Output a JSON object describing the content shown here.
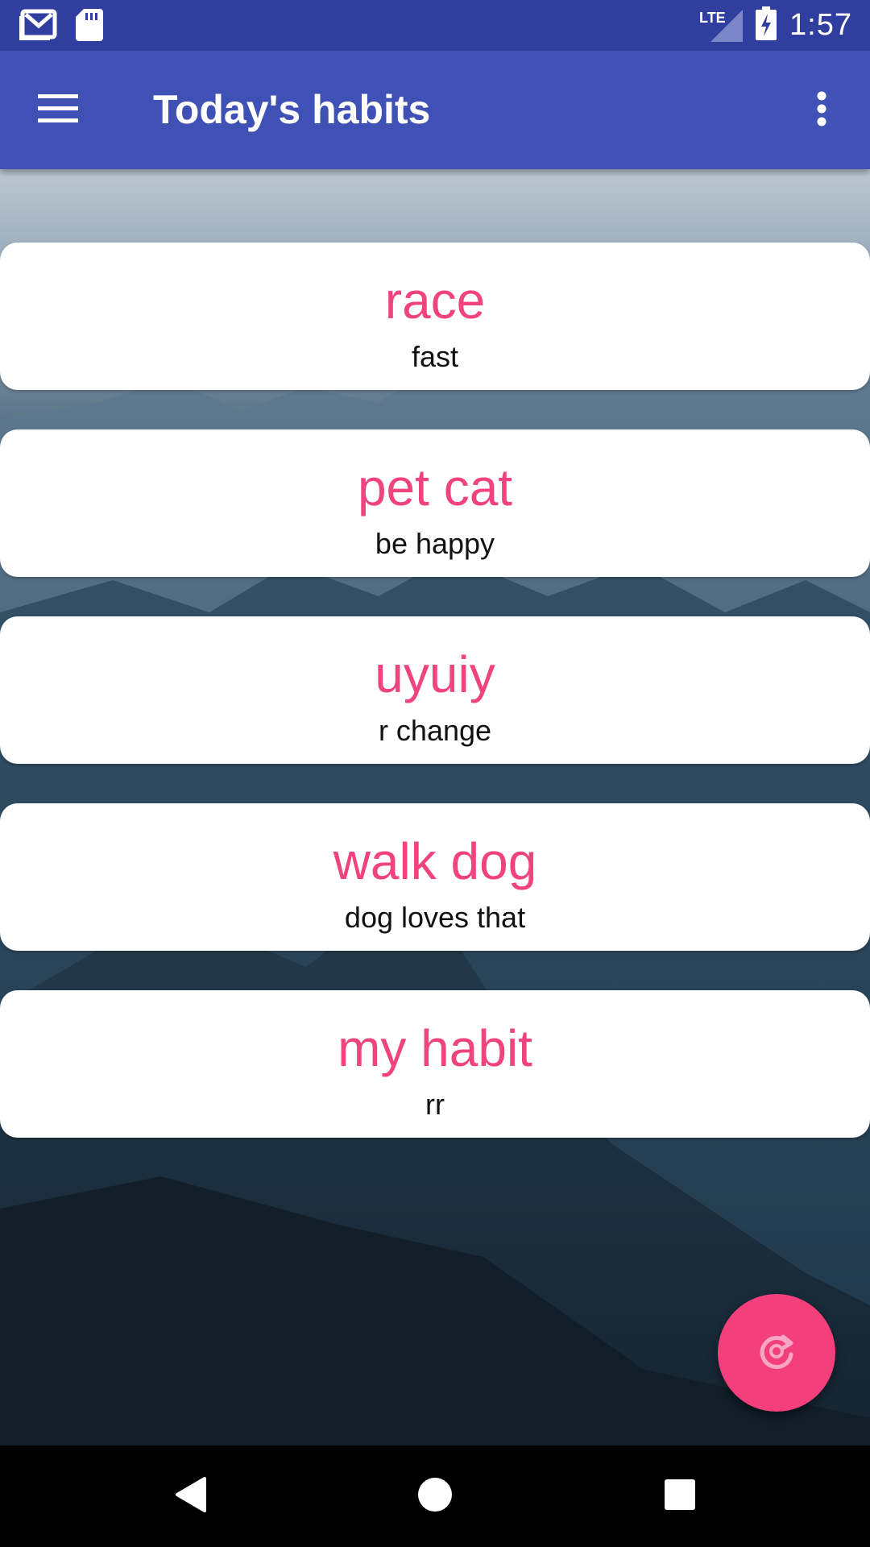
{
  "status_bar": {
    "time": "1:57",
    "network": "LTE",
    "left_icons": [
      "gmail-icon",
      "sd-card-icon"
    ],
    "right_icons": [
      "lte-signal-icon",
      "battery-charging-icon"
    ]
  },
  "app_bar": {
    "title": "Today's habits",
    "menu_icon": "hamburger-menu-icon",
    "overflow_icon": "more-vert-icon",
    "color": "#3f51b5",
    "status_color": "#303f9f"
  },
  "habits": [
    {
      "name": "race",
      "description": "fast"
    },
    {
      "name": "pet cat",
      "description": "be happy"
    },
    {
      "name": "uyuiy",
      "description": "r change"
    },
    {
      "name": "walk dog",
      "description": "dog loves that"
    },
    {
      "name": "my habit",
      "description": "rr"
    }
  ],
  "fab": {
    "icon": "refresh-icon",
    "color": "#f43f7d"
  },
  "nav_bar": {
    "buttons": [
      "back-icon",
      "home-icon",
      "recents-icon"
    ]
  },
  "accent_color": "#f0437f"
}
